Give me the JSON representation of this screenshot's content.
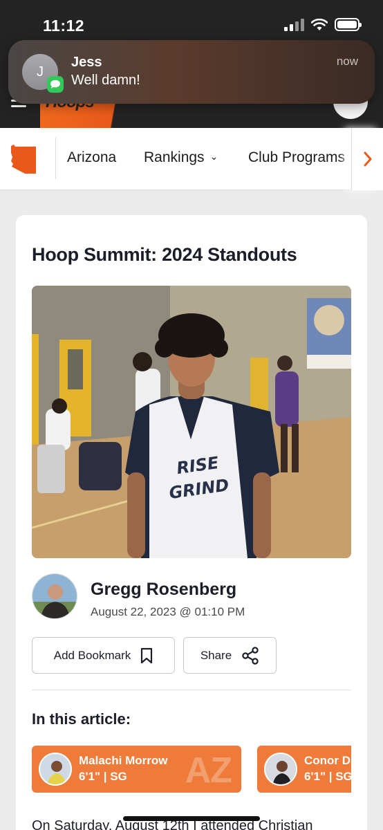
{
  "status_bar": {
    "time": "11:12"
  },
  "notification": {
    "avatar_initial": "J",
    "sender": "Jess",
    "message": "Well damn!",
    "time": "now",
    "app_icon": "messages-icon"
  },
  "header": {
    "logo_text": "Hoops",
    "menu_icon": "hamburger-menu-icon",
    "account_icon": "avatar"
  },
  "nav": {
    "state_icon": "arizona-state-icon",
    "items": [
      {
        "label": "Arizona"
      },
      {
        "label": "Rankings",
        "has_dropdown": true
      },
      {
        "label": "Club Programs"
      }
    ],
    "scroll_icon": "chevron-right-icon"
  },
  "article": {
    "title": "Hoop Summit: 2024 Standouts",
    "photo_jersey_text": "RISE N GRIND",
    "author": {
      "name": "Gregg Rosenberg",
      "date": "August 22, 2023 @ 01:10 PM"
    },
    "actions": {
      "bookmark_label": "Add Bookmark",
      "share_label": "Share"
    },
    "in_this_article_label": "In this article:",
    "players": [
      {
        "name": "Malachi Morrow",
        "meta": "6'1\" | SG",
        "state": "AZ"
      },
      {
        "name": "Conor D",
        "meta": "6'1\" | SG",
        "state": ""
      }
    ],
    "body_preview": "On Saturday, August 12th I attended Christian"
  },
  "colors": {
    "accent": "#ee7b3a",
    "header_bg": "#232323",
    "page_bg": "#ebebeb"
  }
}
